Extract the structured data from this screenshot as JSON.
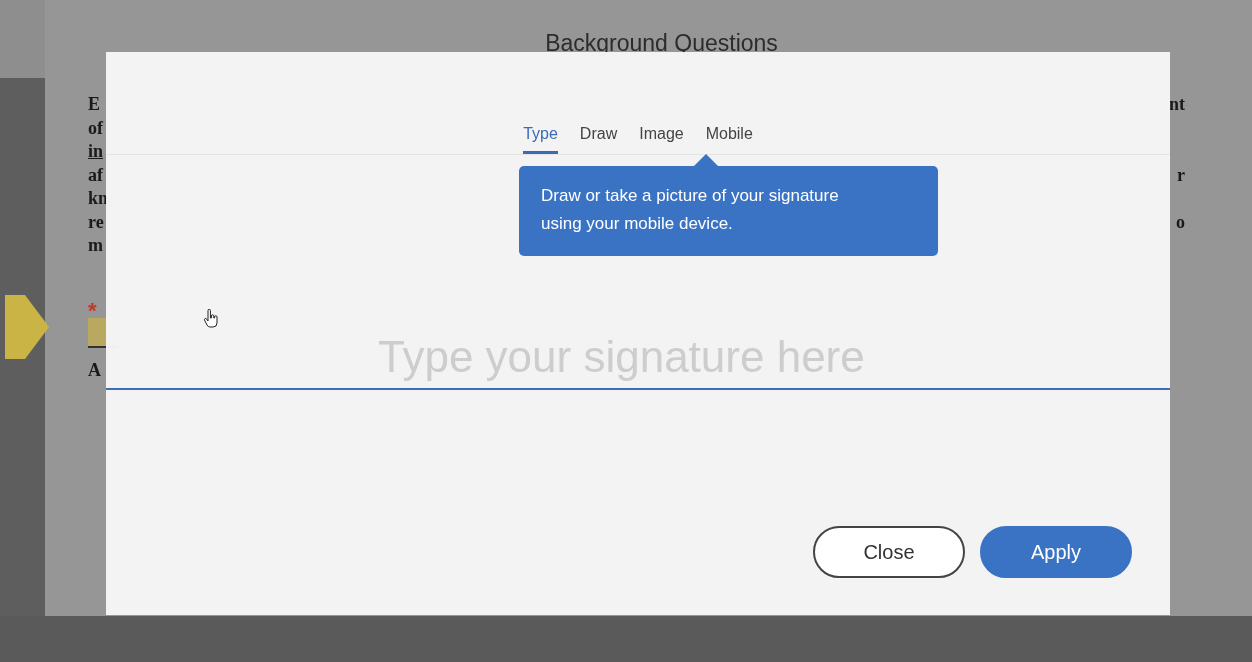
{
  "document": {
    "title": "Background Questions",
    "lines": [
      {
        "left": "E",
        "right": "nt",
        "underlined": false
      },
      {
        "left": "of",
        "underlined": false
      },
      {
        "left": "in",
        "underlined": true
      },
      {
        "left": "af",
        "right": "r",
        "underlined": false
      },
      {
        "left": "kn",
        "underlined": false
      },
      {
        "left": "re",
        "right": "o",
        "underlined": false
      },
      {
        "left": "m",
        "underlined": false
      }
    ],
    "required_mark": "*",
    "field_label": "A"
  },
  "dialog": {
    "tabs": [
      {
        "label": "Type",
        "selected": true
      },
      {
        "label": "Draw",
        "selected": false
      },
      {
        "label": "Image",
        "selected": false
      },
      {
        "label": "Mobile",
        "selected": false
      }
    ],
    "tooltip": "Draw or take a picture of your signature using your mobile device.",
    "signature": {
      "placeholder": "Type your signature here"
    },
    "buttons": [
      {
        "label": "Close",
        "kind": "secondary"
      },
      {
        "label": "Apply",
        "kind": "primary"
      }
    ]
  }
}
